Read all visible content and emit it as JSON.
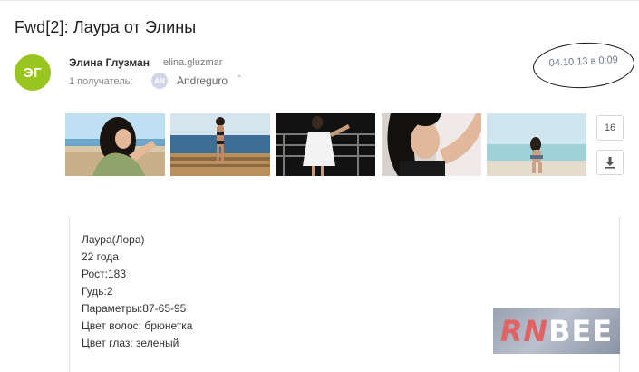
{
  "message": {
    "subject": "Fwd[2]: Лаура от Элины",
    "sender": {
      "initials": "ЭГ",
      "name": "Элина Глузман",
      "email": "elina.gluzmar",
      "avatar_color": "#98c51f"
    },
    "recipients": {
      "label": "1 получатель:",
      "avatar_initials": "AN",
      "name": "Andreguro",
      "toggle_icon": "chevron-up-icon"
    },
    "date": "04.10.13 в 0:09"
  },
  "attachments": {
    "count": "16",
    "download_icon": "download-icon",
    "thumbnails": [
      {
        "name": "photo-1"
      },
      {
        "name": "photo-2"
      },
      {
        "name": "photo-3"
      },
      {
        "name": "photo-4"
      },
      {
        "name": "photo-5"
      }
    ]
  },
  "body": {
    "lines": [
      "Лаура(Лора)",
      "22 года",
      "Рост:183",
      "Гудь:2",
      "Параметры:87-65-95",
      "Цвет волос: брюнетка",
      "Цвет глаз: зеленый"
    ]
  },
  "watermark": {
    "part1": "RN",
    "part2": "BEE"
  }
}
